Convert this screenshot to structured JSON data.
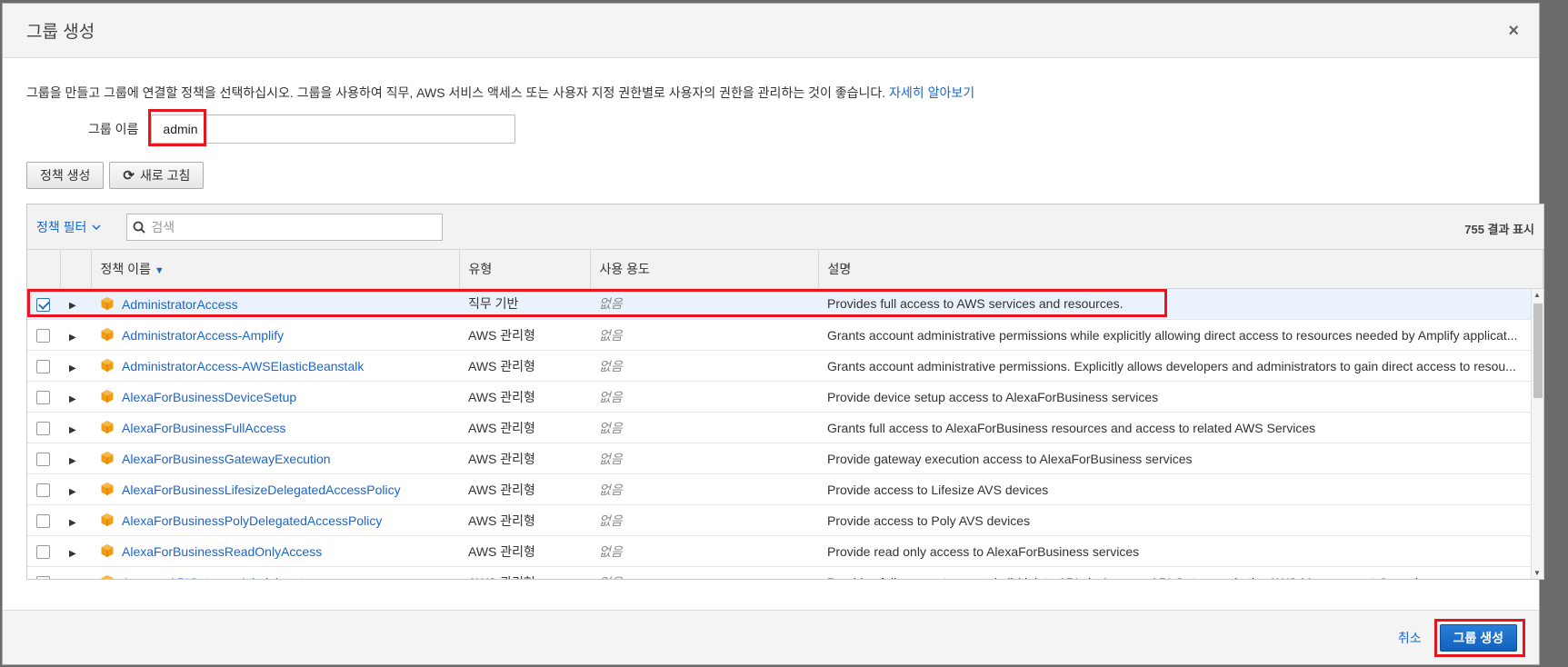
{
  "dialog": {
    "title": "그룹 생성",
    "close_glyph": "×"
  },
  "intro": {
    "text": "그룹을 만들고 그룹에 연결할 정책을 선택하십시오. 그룹을 사용하여 직무, AWS 서비스 액세스 또는 사용자 지정 권한별로 사용자의 권한을 관리하는 것이 좋습니다. ",
    "learn_more": "자세히 알아보기"
  },
  "group_name": {
    "label": "그룹 이름",
    "value": "admin"
  },
  "toolbar": {
    "create_policy": "정책 생성",
    "refresh": "새로 고침"
  },
  "filter": {
    "label": "정책 필터",
    "search_placeholder": "검색",
    "result_count": "755 결과 표시"
  },
  "columns": {
    "policy_name": "정책 이름",
    "type": "유형",
    "usage": "사용 용도",
    "description": "설명"
  },
  "policies": [
    {
      "name": "AdministratorAccess",
      "type": "직무 기반",
      "usage": "없음",
      "description": "Provides full access to AWS services and resources.",
      "checked": true
    },
    {
      "name": "AdministratorAccess-Amplify",
      "type": "AWS 관리형",
      "usage": "없음",
      "description": "Grants account administrative permissions while explicitly allowing direct access to resources needed by Amplify applicat...",
      "checked": false
    },
    {
      "name": "AdministratorAccess-AWSElasticBeanstalk",
      "type": "AWS 관리형",
      "usage": "없음",
      "description": "Grants account administrative permissions. Explicitly allows developers and administrators to gain direct access to resou...",
      "checked": false
    },
    {
      "name": "AlexaForBusinessDeviceSetup",
      "type": "AWS 관리형",
      "usage": "없음",
      "description": "Provide device setup access to AlexaForBusiness services",
      "checked": false
    },
    {
      "name": "AlexaForBusinessFullAccess",
      "type": "AWS 관리형",
      "usage": "없음",
      "description": "Grants full access to AlexaForBusiness resources and access to related AWS Services",
      "checked": false
    },
    {
      "name": "AlexaForBusinessGatewayExecution",
      "type": "AWS 관리형",
      "usage": "없음",
      "description": "Provide gateway execution access to AlexaForBusiness services",
      "checked": false
    },
    {
      "name": "AlexaForBusinessLifesizeDelegatedAccessPolicy",
      "type": "AWS 관리형",
      "usage": "없음",
      "description": "Provide access to Lifesize AVS devices",
      "checked": false
    },
    {
      "name": "AlexaForBusinessPolyDelegatedAccessPolicy",
      "type": "AWS 관리형",
      "usage": "없음",
      "description": "Provide access to Poly AVS devices",
      "checked": false
    },
    {
      "name": "AlexaForBusinessReadOnlyAccess",
      "type": "AWS 관리형",
      "usage": "없음",
      "description": "Provide read only access to AlexaForBusiness services",
      "checked": false
    },
    {
      "name": "AmazonAPIGatewayAdministrator",
      "type": "AWS 관리형",
      "usage": "없음",
      "description": "Provides full access to create/edit/delete APIs in Amazon API Gateway via the AWS Management Console",
      "checked": false
    }
  ],
  "footer": {
    "cancel": "취소",
    "create_group": "그룹 생성"
  },
  "colors": {
    "link": "#1b66c9",
    "highlight": "#e8151f",
    "policy_icon": "#f39c12",
    "primary": "#1a6fcf"
  },
  "icons": {
    "policy": "cube-icon",
    "search": "search-icon",
    "refresh": "refresh-icon"
  }
}
